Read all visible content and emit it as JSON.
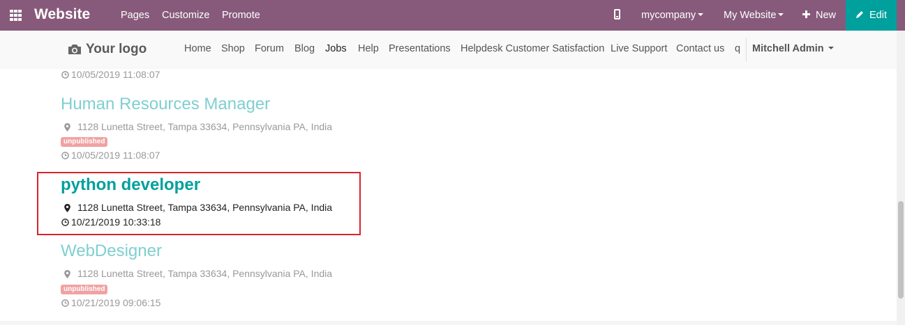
{
  "admin_bar": {
    "brand": "Website",
    "menu": [
      "Pages",
      "Customize",
      "Promote"
    ],
    "company_menu": "mycompany",
    "website_menu": "My Website",
    "new_label": "New",
    "edit_label": "Edit",
    "color": "#875a7b",
    "edit_color": "#00a09d"
  },
  "site_header": {
    "logo_text": "Your logo",
    "nav": [
      "Home",
      "Shop",
      "Forum",
      "Blog",
      "Jobs",
      "Help",
      "Presentations",
      "Helpdesk Customer Satisfaction",
      "Live Support",
      "Contact us",
      "q"
    ],
    "active_nav": "Jobs",
    "user": "Mitchell Admin"
  },
  "jobs": {
    "previous_date": "10/05/2019 11:08:07",
    "items": [
      {
        "title": "Human Resources Manager",
        "address": "1128 Lunetta Street, Tampa 33634, Pennsylvania PA, India",
        "badge": "unpublished",
        "date": "10/05/2019 11:08:07"
      },
      {
        "title": "python developer",
        "address": "1128 Lunetta Street, Tampa 33634, Pennsylvania PA, India",
        "date": "10/21/2019 10:33:18"
      },
      {
        "title": "WebDesigner",
        "address": "1128 Lunetta Street, Tampa 33634, Pennsylvania PA, India",
        "badge": "unpublished",
        "date": "10/21/2019 09:06:15"
      }
    ]
  },
  "icons": {
    "apps": "apps-grid-icon",
    "mobile": "mobile-icon",
    "plus": "plus-icon",
    "pencil": "pencil-icon",
    "camera": "camera-icon",
    "pin": "map-marker-icon",
    "clock": "clock-icon"
  },
  "colors": {
    "highlight": "#d8232a",
    "faded_title": "#7fcfcf",
    "title": "#00a09d",
    "badge": "#f0a2a2"
  }
}
